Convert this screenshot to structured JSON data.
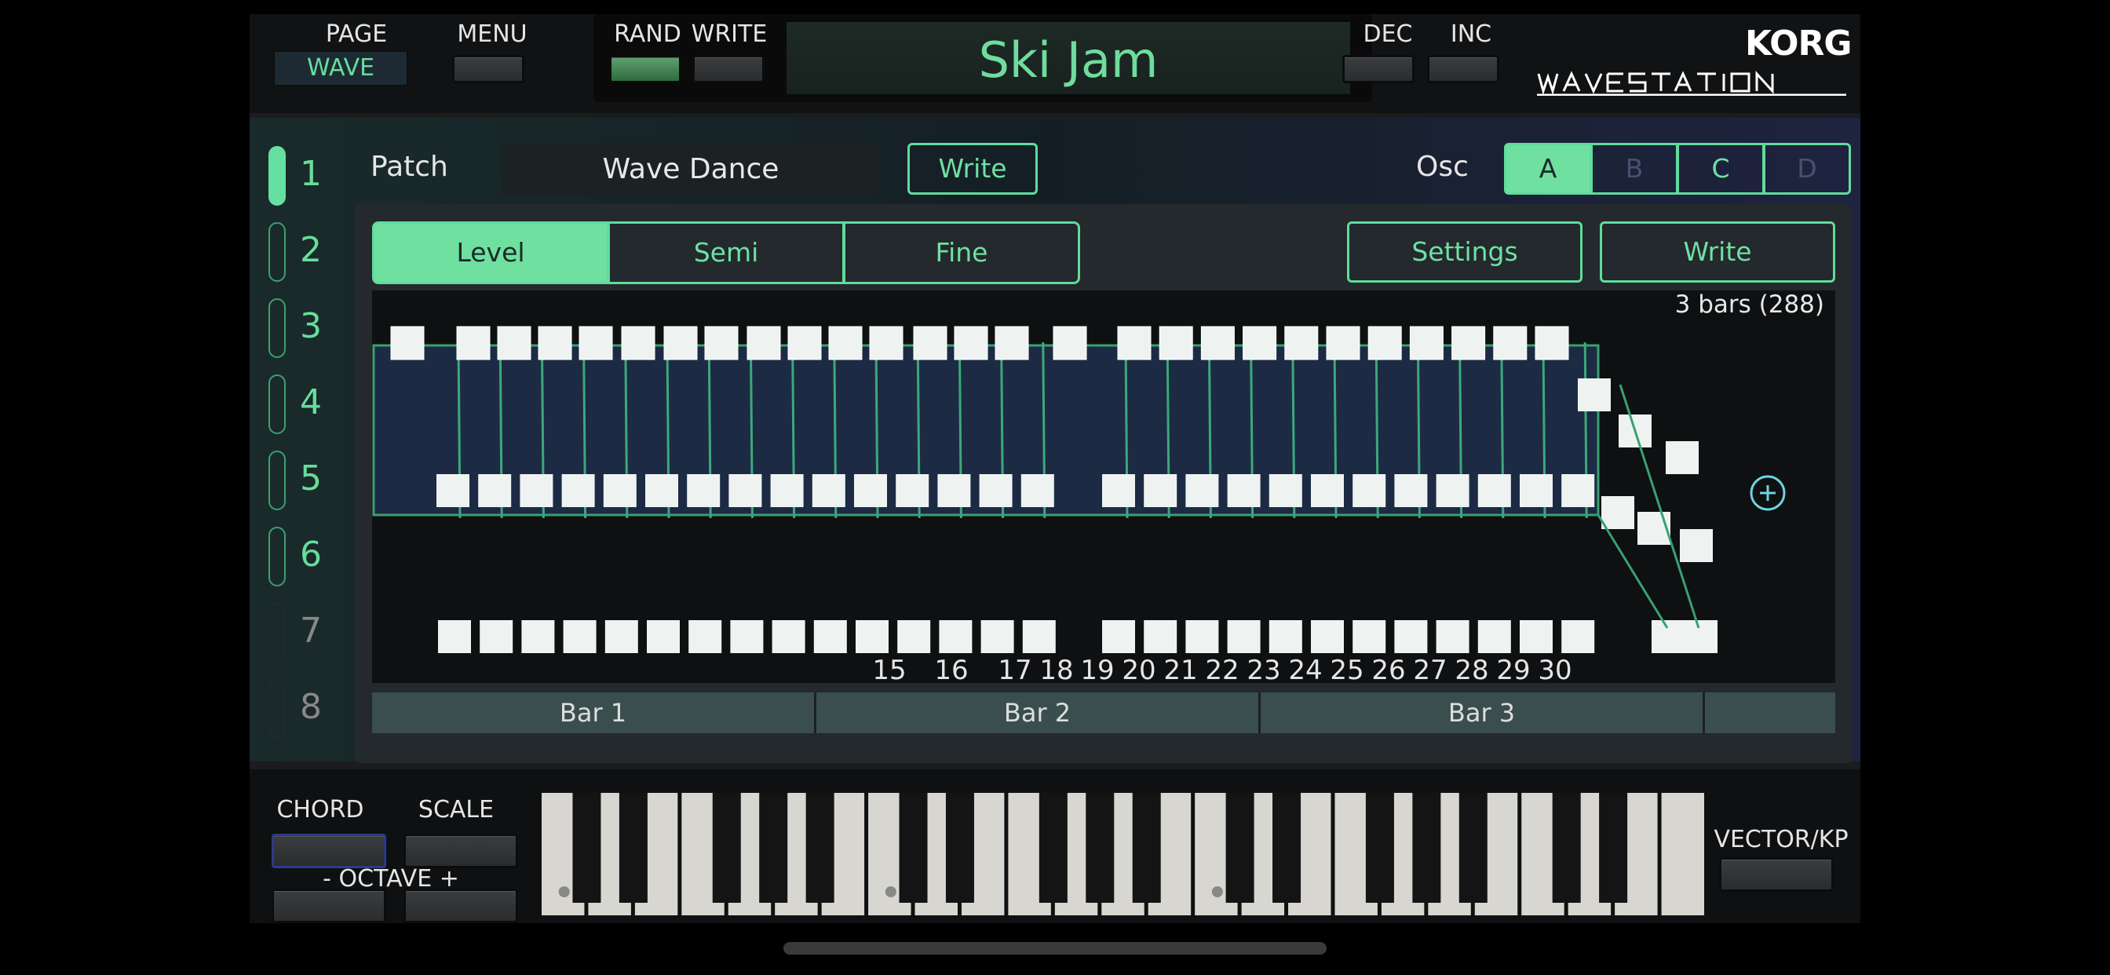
{
  "topbar": {
    "page_label": "PAGE",
    "page_value": "WAVE",
    "menu_label": "MENU",
    "rand_label": "RAND",
    "write_label": "WRITE",
    "lcd_text": "Ski Jam",
    "dec_label": "DEC",
    "inc_label": "INC",
    "brand": "KORG",
    "product": "WAVESTATION"
  },
  "patches": [
    {
      "num": "1",
      "state": "active"
    },
    {
      "num": "2",
      "state": "on"
    },
    {
      "num": "3",
      "state": "on"
    },
    {
      "num": "4",
      "state": "on"
    },
    {
      "num": "5",
      "state": "on"
    },
    {
      "num": "6",
      "state": "on"
    },
    {
      "num": "7",
      "state": "off"
    },
    {
      "num": "8",
      "state": "off"
    }
  ],
  "patch": {
    "label": "Patch",
    "name": "Wave Dance",
    "write_label": "Write"
  },
  "osc": {
    "label": "Osc",
    "options": [
      "A",
      "B",
      "C",
      "D"
    ],
    "selected": "A"
  },
  "tabs": {
    "items": [
      "Level",
      "Semi",
      "Fine"
    ],
    "selected": "Level",
    "settings_label": "Settings",
    "write_label": "Write"
  },
  "sequence": {
    "length_label": "3 bars (288)",
    "step_numbers": [
      "15",
      "16",
      "17",
      "18",
      "19",
      "20",
      "21",
      "22",
      "23",
      "24",
      "25",
      "26",
      "27",
      "28",
      "29",
      "30"
    ],
    "add_icon": "plus-circle-icon"
  },
  "bars": [
    "Bar 1",
    "Bar 2",
    "Bar 3"
  ],
  "keyboard": {
    "chord_label": "CHORD",
    "scale_label": "SCALE",
    "octave_label": "- OCTAVE +",
    "vector_label": "VECTOR/KP"
  },
  "colors": {
    "accent": "#6fe0a0",
    "lcd": "#6fdc9e"
  }
}
